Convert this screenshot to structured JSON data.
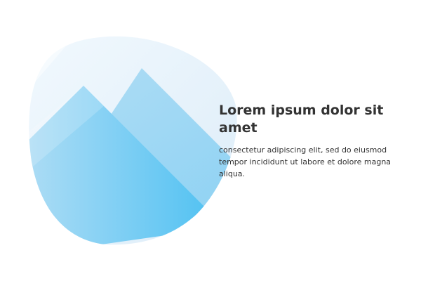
{
  "hero": {
    "title": "Lorem ipsum dolor sit amet",
    "description": "consectetur adipiscing elit, sed do eiusmod tempor incididunt ut labore et dolore magna aliqua."
  },
  "illustration": {
    "icon": "mountain-blob-illustration",
    "colors": {
      "light": "#e8f4fc",
      "mid": "#a9dbf4",
      "accent": "#45bff2"
    }
  }
}
